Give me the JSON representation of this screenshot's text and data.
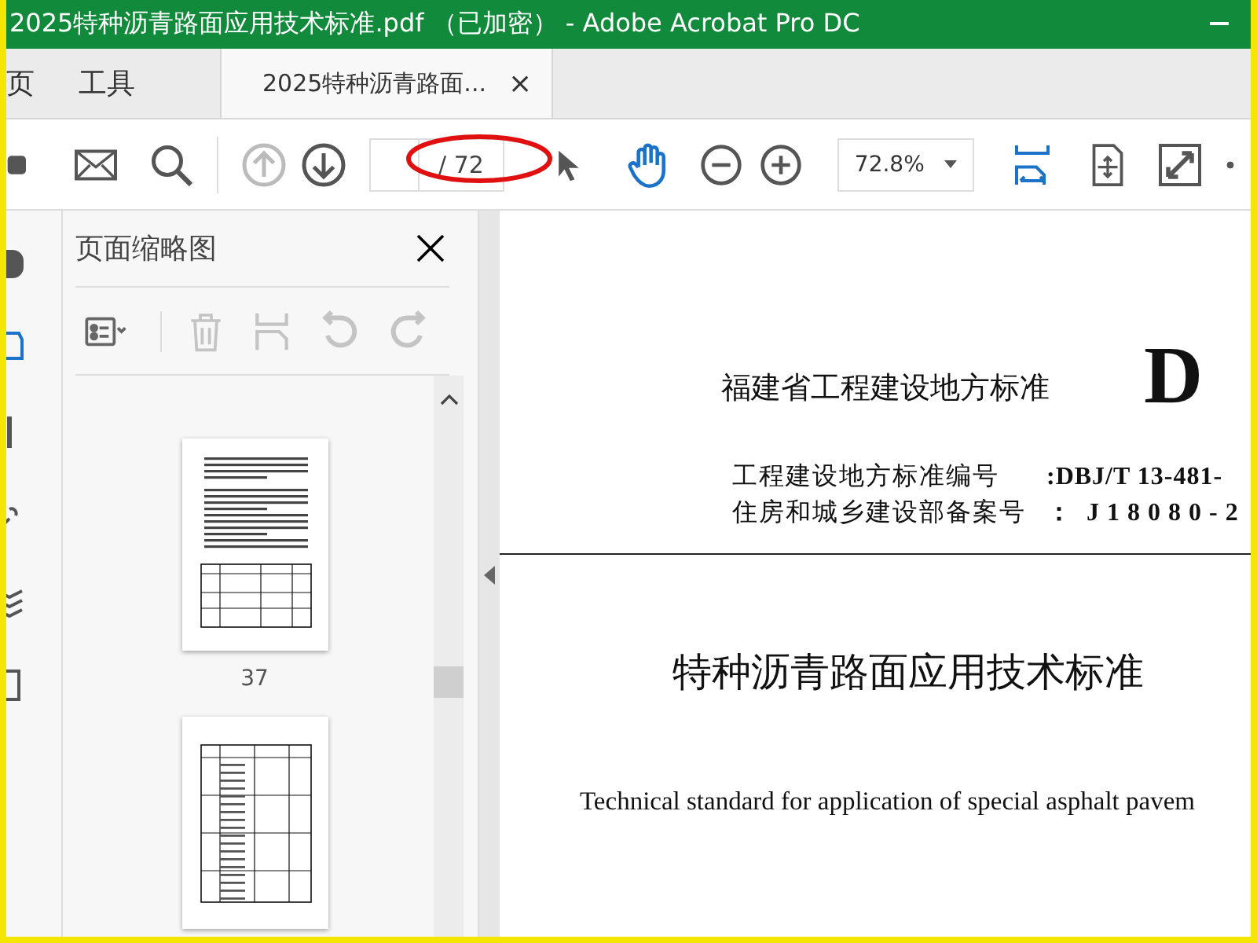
{
  "window": {
    "title": "2025特种沥青路面应用技术标准.pdf （已加密） - Adobe Acrobat Pro DC"
  },
  "tabs": [
    {
      "label": "页",
      "selected": false
    },
    {
      "label": "工具",
      "selected": false
    },
    {
      "label": "2025特种沥青路面...",
      "selected": true,
      "close": "×"
    }
  ],
  "toolbar": {
    "page_total": "/ 72",
    "zoom": "72.8%",
    "prev_disabled": true
  },
  "panel": {
    "title": "页面缩略图",
    "thumbnails": [
      {
        "kind": "text-page",
        "label": "37"
      },
      {
        "kind": "table-page"
      }
    ]
  },
  "document": {
    "series": "福建省工程建设地方标准",
    "code": "D",
    "numbers": [
      {
        "label": "工程建设地方标准编号",
        "value": ":DBJ/T 13-481-"
      },
      {
        "label": "住房和城乡建设部备案号",
        "value": "：  J 1 8 0 8 0 - 2"
      }
    ],
    "title": "特种沥青路面应用技术标准",
    "subtitle": "Technical standard for application of special asphalt pavem"
  }
}
